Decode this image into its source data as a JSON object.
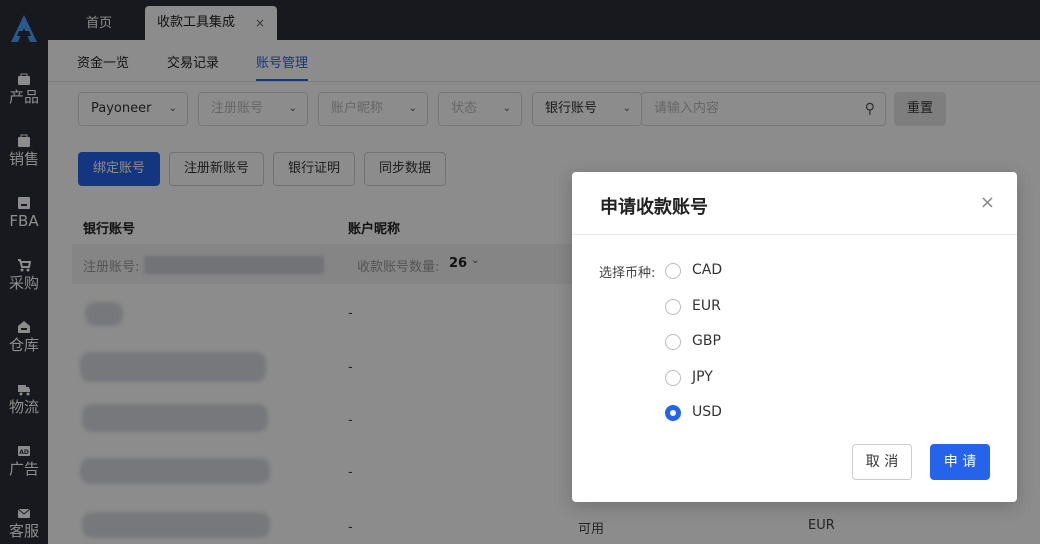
{
  "top_tabs": {
    "home": "首页",
    "active": "收款工具集成",
    "close": "×"
  },
  "subnav": [
    "资金一览",
    "交易记录",
    "账号管理"
  ],
  "sidebar": [
    "产品",
    "销售",
    "FBA",
    "采购",
    "仓库",
    "物流",
    "广告",
    "客服"
  ],
  "filters": {
    "platform": "Payoneer",
    "reg_account": "注册账号",
    "nickname": "账户昵称",
    "status": "状态",
    "bank_account": "银行账号",
    "search_placeholder": "请输入内容",
    "reset": "重置"
  },
  "actions": {
    "bind": "绑定账号",
    "register": "注册新账号",
    "bank_proof": "银行证明",
    "sync": "同步数据"
  },
  "table": {
    "headers": [
      "银行账号",
      "账户昵称"
    ],
    "group_label": "注册账号:",
    "count_label": "收款账号数量:",
    "count_value": "26",
    "dash": "-",
    "last_status": "可用",
    "last_currency": "EUR"
  },
  "modal": {
    "title": "申请收款账号",
    "close": "×",
    "field_label": "选择币种:",
    "options": [
      "CAD",
      "EUR",
      "GBP",
      "JPY",
      "USD"
    ],
    "selected": "USD",
    "cancel": "取 消",
    "submit": "申 请"
  },
  "colors": {
    "primary": "#2563eb",
    "sidebar": "#2b2f3a"
  }
}
